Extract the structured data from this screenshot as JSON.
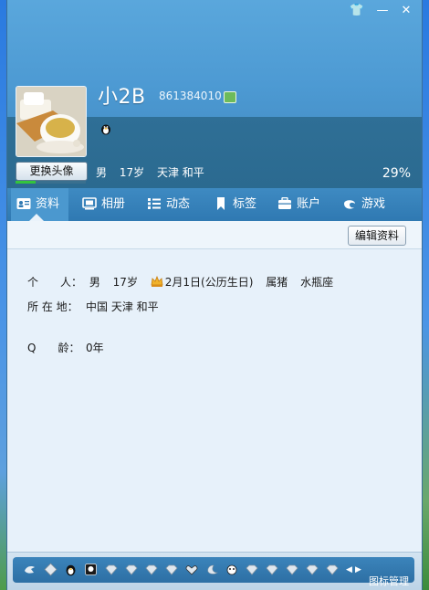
{
  "window": {
    "controls": {
      "skin": "👕",
      "minimize": "—",
      "close": "✕"
    }
  },
  "profile": {
    "nickname": "小2B",
    "qq_number": "861384010",
    "change_avatar_label": "更换头像",
    "gender": "男",
    "age": "17岁",
    "location": "天津 和平",
    "completion_percent": "29%",
    "completion_fraction": 0.29
  },
  "tabs": [
    {
      "label": "资料",
      "icon": "profile-card-icon",
      "active": true
    },
    {
      "label": "相册",
      "icon": "album-icon"
    },
    {
      "label": "动态",
      "icon": "feed-icon"
    },
    {
      "label": "标签",
      "icon": "bookmark-icon"
    },
    {
      "label": "账户",
      "icon": "wallet-icon"
    },
    {
      "label": "游戏",
      "icon": "game-icon"
    }
  ],
  "edit_button": "编辑资料",
  "details": {
    "person_label": "个　　人：",
    "gender": "男",
    "age": "17岁",
    "birthday": "2月1日(公历生日)",
    "zodiac": "属猪",
    "constellation": "水瓶座",
    "location_label": "所 在 地：",
    "location": "中国 天津 和平",
    "q_age_label": "Q　　龄：",
    "q_age": "0年"
  },
  "bottom": {
    "icon_manage_label": "图标管理",
    "icons": [
      "bird-icon",
      "diamond-icon",
      "penguin-icon",
      "qq-card-icon",
      "gem-icon",
      "gem-icon",
      "gem-icon",
      "gem-icon",
      "heart-gem-icon",
      "moon-icon",
      "pet-icon",
      "gem-icon",
      "gem-icon",
      "gem-icon",
      "gem-icon",
      "gem-icon"
    ]
  },
  "colors": {
    "header": "#4d9ad3",
    "tabbar": "#2f79b2",
    "progress": "#34c43c",
    "content_bg": "#e7f1fa"
  }
}
